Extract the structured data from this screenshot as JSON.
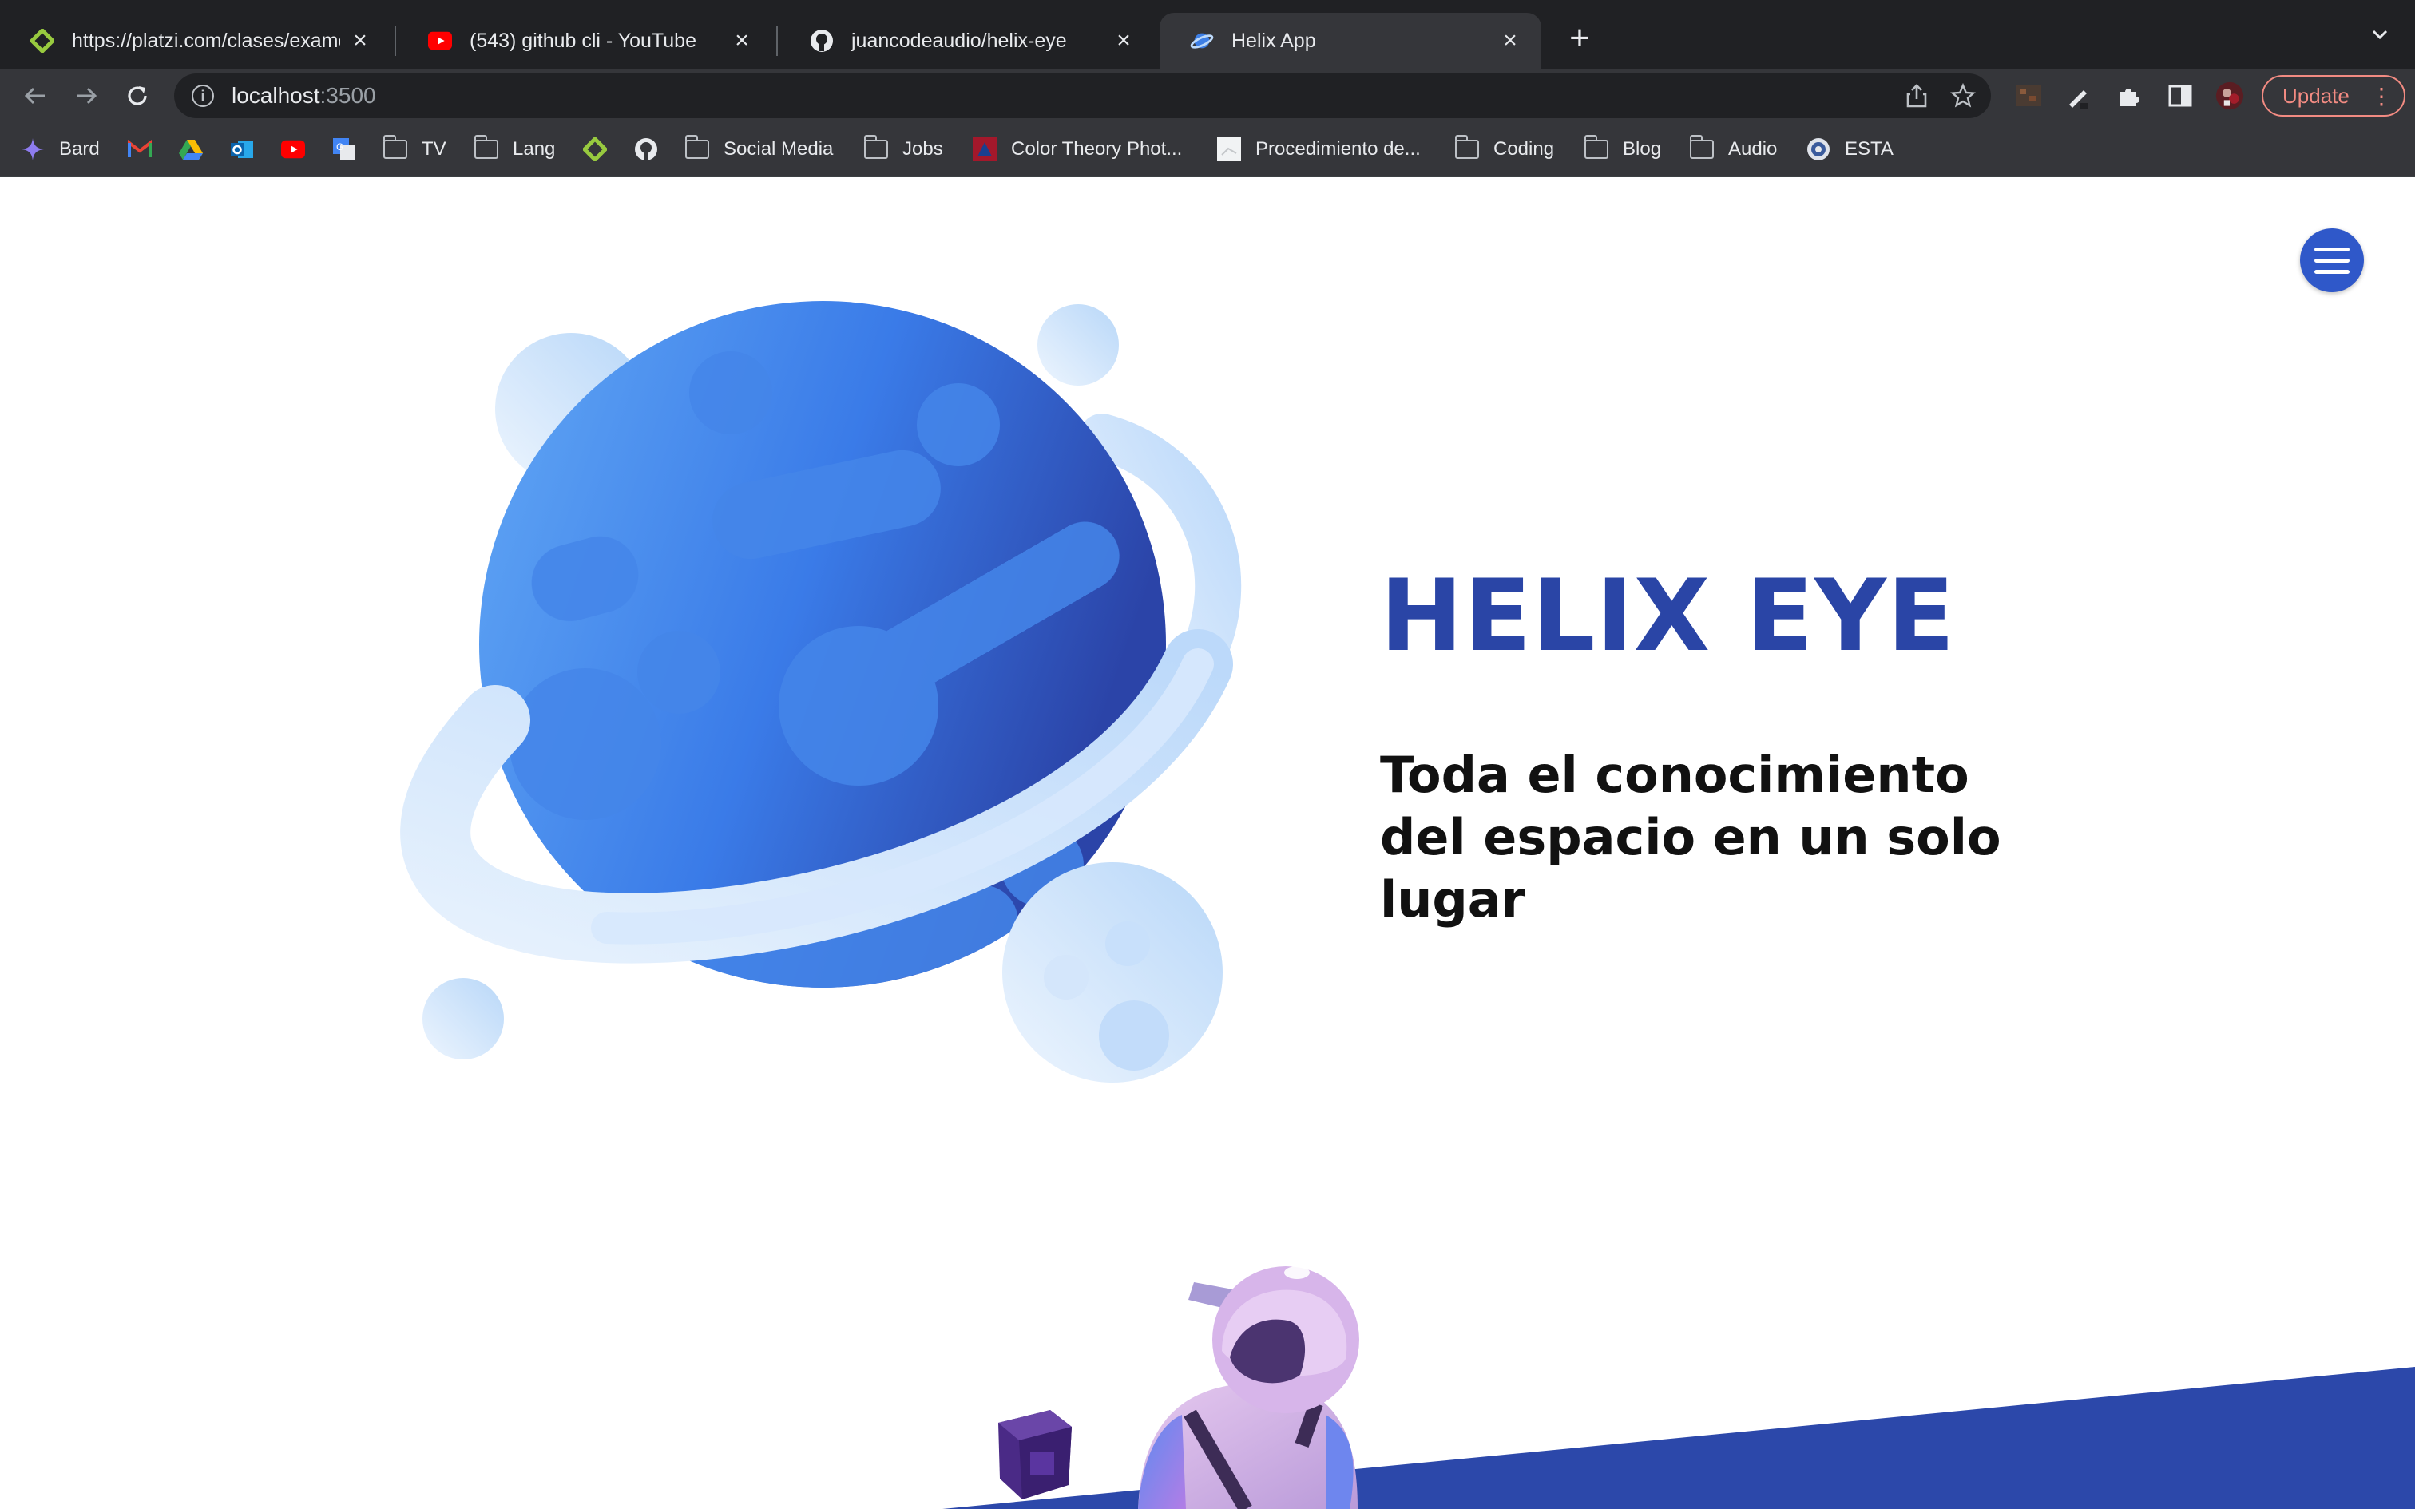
{
  "browser": {
    "tabs": [
      {
        "title": "https://platzi.com/clases/examen",
        "icon": "platzi-icon"
      },
      {
        "title": "(543) github cli - YouTube",
        "icon": "youtube-icon"
      },
      {
        "title": "juancodeaudio/helix-eye",
        "icon": "github-icon"
      },
      {
        "title": "Helix App",
        "icon": "helix-app-icon",
        "active": true
      }
    ],
    "address": {
      "host": "localhost",
      "port": ":3500"
    },
    "update_label": "Update",
    "bookmarks": [
      {
        "label": "Bard",
        "icon": "bard-icon"
      },
      {
        "label": "",
        "icon": "gmail-icon"
      },
      {
        "label": "",
        "icon": "google-drive-icon"
      },
      {
        "label": "",
        "icon": "outlook-icon"
      },
      {
        "label": "",
        "icon": "youtube-icon"
      },
      {
        "label": "",
        "icon": "google-translate-icon"
      },
      {
        "label": "TV",
        "icon": "folder-icon"
      },
      {
        "label": "Lang",
        "icon": "folder-icon"
      },
      {
        "label": "",
        "icon": "platzi-icon"
      },
      {
        "label": "",
        "icon": "github-icon"
      },
      {
        "label": "Social Media",
        "icon": "folder-icon"
      },
      {
        "label": "Jobs",
        "icon": "folder-icon"
      },
      {
        "label": "Color Theory Phot...",
        "icon": "adobe-icon"
      },
      {
        "label": "Procedimiento de...",
        "icon": "document-icon"
      },
      {
        "label": "Coding",
        "icon": "folder-icon"
      },
      {
        "label": "Blog",
        "icon": "folder-icon"
      },
      {
        "label": "Audio",
        "icon": "folder-icon"
      },
      {
        "label": "ESTA",
        "icon": "esta-seal-icon"
      }
    ]
  },
  "page": {
    "title": "HELIX EYE",
    "subtitle": "Toda el conocimiento del espacio en un solo lugar",
    "colors": {
      "brand_blue": "#2a45a6",
      "menu_blue": "#2f58c9",
      "planet_light": "#62a8f5",
      "planet_dark": "#2b44a8",
      "ring": "#c8e0fb",
      "band": "#2c48aa"
    }
  }
}
